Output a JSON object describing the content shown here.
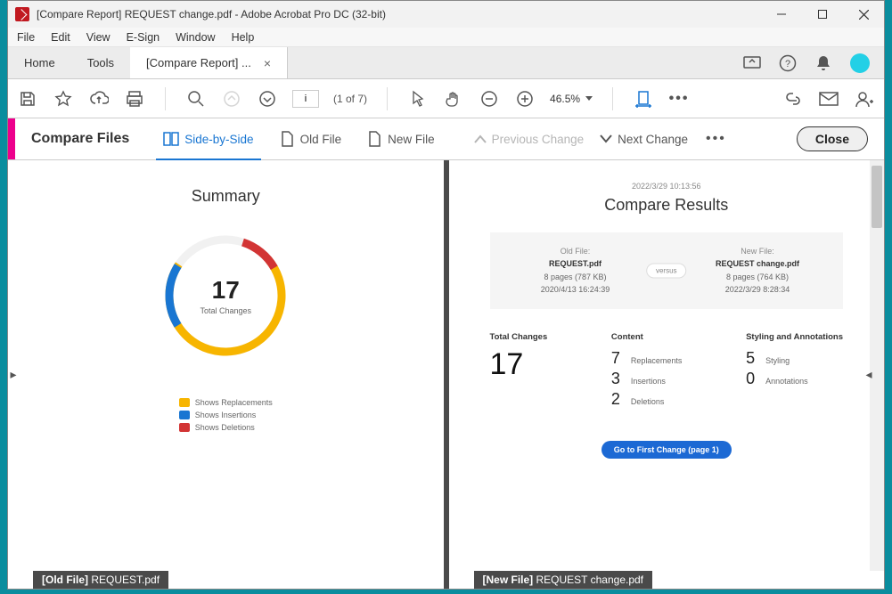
{
  "window": {
    "title": "[Compare Report] REQUEST change.pdf - Adobe Acrobat Pro DC (32-bit)"
  },
  "menubar": [
    "File",
    "Edit",
    "View",
    "E-Sign",
    "Window",
    "Help"
  ],
  "tabs": {
    "home": "Home",
    "tools": "Tools",
    "document": "[Compare Report] ..."
  },
  "toolbar": {
    "page_input": "i",
    "page_of": "(1 of 7)",
    "zoom": "46.5%"
  },
  "compare_bar": {
    "title": "Compare Files",
    "side_by_side": "Side-by-Side",
    "old_file": "Old File",
    "new_file": "New File",
    "prev": "Previous Change",
    "next": "Next Change",
    "close": "Close"
  },
  "left_page": {
    "heading": "Summary",
    "total_number": "17",
    "total_label": "Total Changes",
    "legend_rep": "Shows Replacements",
    "legend_ins": "Shows Insertions",
    "legend_del": "Shows Deletions",
    "footer_prefix": "[Old File]",
    "footer_name": " REQUEST.pdf"
  },
  "right_page": {
    "timestamp": "2022/3/29 10:13:56",
    "heading": "Compare Results",
    "old_label": "Old File:",
    "old_name": "REQUEST.pdf",
    "old_meta1": "8 pages (787 KB)",
    "old_meta2": "2020/4/13 16:24:39",
    "versus": "versus",
    "new_label": "New File:",
    "new_name": "REQUEST change.pdf",
    "new_meta1": "8 pages (764 KB)",
    "new_meta2": "2022/3/29 8:28:34",
    "total_hdr": "Total Changes",
    "total_val": "17",
    "content_hdr": "Content",
    "content_rep_n": "7",
    "content_rep_l": "Replacements",
    "content_ins_n": "3",
    "content_ins_l": "Insertions",
    "content_del_n": "2",
    "content_del_l": "Deletions",
    "style_hdr": "Styling and Annotations",
    "style_n": "5",
    "style_l": "Styling",
    "annot_n": "0",
    "annot_l": "Annotations",
    "goto_btn": "Go to First Change (page 1)",
    "footer_prefix": "[New File]",
    "footer_name": " REQUEST change.pdf"
  },
  "chart_data": {
    "type": "pie",
    "title": "Total Changes",
    "total": 17,
    "series": [
      {
        "name": "Replacements",
        "value": 7,
        "color": "#f7b500"
      },
      {
        "name": "Insertions",
        "value": 3,
        "color": "#1976d2"
      },
      {
        "name": "Deletions",
        "value": 2,
        "color": "#d23434"
      },
      {
        "name": "Styling",
        "value": 5,
        "color": "#f7b500"
      },
      {
        "name": "Annotations",
        "value": 0,
        "color": "#f7b500"
      }
    ]
  }
}
